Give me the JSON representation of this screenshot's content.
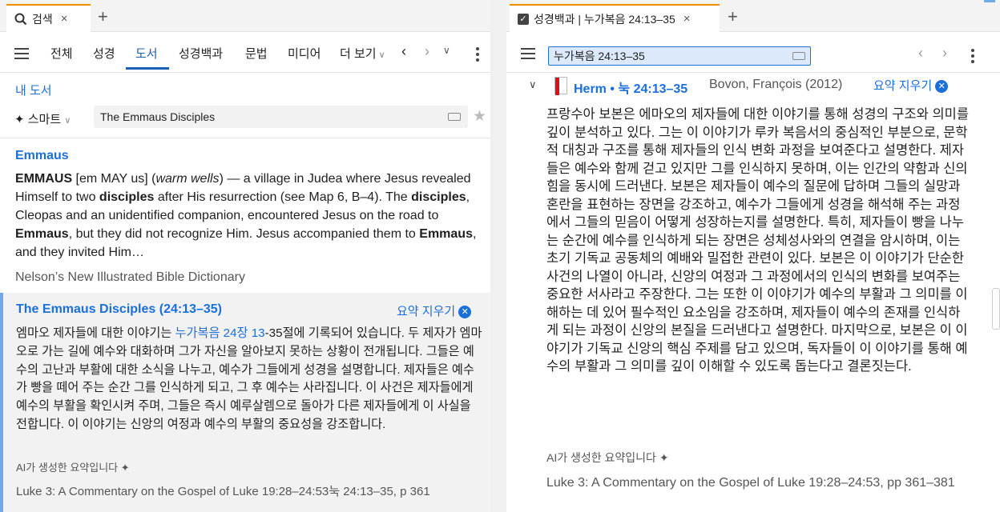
{
  "left": {
    "tab": {
      "label": "검색",
      "icon": "search-icon",
      "close": "×"
    },
    "new_tab": "+",
    "nav": [
      "전체",
      "성경",
      "도서",
      "성경백과",
      "문법",
      "미디어",
      "더 보기"
    ],
    "active_nav": "도서",
    "my_library": "내 도서",
    "smart_label": "스마트",
    "search_value": "The Emmaus Disciples",
    "entry": {
      "title": "Emmaus",
      "headword": "EMMAUS",
      "pron": " [em MAY us] (",
      "gloss": "warm wells",
      "t1": ") — a village in Judea where Jesus revealed Himself to two ",
      "b1": "disciples",
      "t2": " after His resurrection (see Map 6, B–4). The ",
      "b2": "disciples",
      "t3": ", Cleopas and an unidentified companion, encountered Jesus on the road to ",
      "b3": "Emmaus",
      "t4": ", but they did not recognize Him. Jesus accompanied them to ",
      "b4": "Emmaus",
      "t5": ", and they invited Him…",
      "source": "Nelson’s New Illustrated Bible Dictionary"
    },
    "summary": {
      "title": "The Emmaus Disciples (24:13–35)",
      "clear": "요약 지우기",
      "pre": "엠마오 제자들에 대한 이야기는 ",
      "link": "누가복음 24장 13",
      "body": "-35절에 기록되어 있습니다. 두 제자가 엠마오로 가는 길에 예수와 대화하며 그가 자신을 알아보지 못하는 상황이 전개됩니다. 그들은 예수의 고난과 부활에 대한 소식을 나누고, 예수가 그들에게 성경을 설명합니다. 제자들은 예수가 빵을 떼어 주는 순간 그를 인식하게 되고, 그 후 예수는 사라집니다. 이 사건은 제자들에게 예수의 부활을 확인시켜 주며, 그들은 즉시 예루살렘으로 돌아가 다른 제자들에게 이 사실을 전합니다. 이 이야기는 신앙의 여정과 예수의 부활의 중요성을 강조합니다.",
      "ai_note": "AI가 생성한 요약입니다",
      "source": "Luke 3: A Commentary on the Gospel of Luke 19:28–24:53눅 24:13–35, p 361"
    }
  },
  "right": {
    "tab": {
      "label": "성경백과 | 누가복음 24:13–35",
      "close": "×"
    },
    "new_tab": "+",
    "address": "누가복음 24:13–35",
    "result": {
      "resource": "Herm • 눅 24:13–35",
      "author": "Bovon, François (2012)",
      "clear": "요약 지우기",
      "body": "프랑수아 보본은 에마오의 제자들에 대한 이야기를 통해 성경의 구조와 의미를 깊이 분석하고 있다. 그는 이 이야기가 루카 복음서의 중심적인 부분으로, 문학적 대칭과 구조를 통해 제자들의 인식 변화 과정을 보여준다고 설명한다. 제자들은 예수와 함께 걷고 있지만 그를 인식하지 못하며, 이는 인간의 약함과 신의 힘을 동시에 드러낸다. 보본은 제자들이 예수의 질문에 답하며 그들의 실망과 혼란을 표현하는 장면을 강조하고, 예수가 그들에게 성경을 해석해 주는 과정에서 그들의 믿음이 어떻게 성장하는지를 설명한다. 특히, 제자들이 빵을 나누는 순간에 예수를 인식하게 되는 장면은 성체성사와의 연결을 암시하며, 이는 초기 기독교 공동체의 예배와 밀접한 관련이 있다. 보본은 이 이야기가 단순한 사건의 나열이 아니라, 신앙의 여정과 그 과정에서의 인식의 변화를 보여주는 중요한 서사라고 주장한다. 그는 또한 이 이야기가 예수의 부활과 그 의미를 이해하는 데 있어 필수적인 요소임을 강조하며, 제자들이 예수의 존재를 인식하게 되는 과정이 신앙의 본질을 드러낸다고 설명한다. 마지막으로, 보본은 이 이야기가 기독교 신앙의 핵심 주제를 담고 있으며, 독자들이 이 이야기를 통해 예수의 부활과 그 의미를 깊이 이해할 수 있도록 돕는다고 결론짓는다.",
      "ai_note": "AI가 생성한 요약입니다",
      "source": "Luke 3: A Commentary on the Gospel of Luke 19:28–24:53, pp 361–381"
    }
  },
  "colors": {
    "accent": "#1a6fd9",
    "tab_marker": "#f08c00",
    "summary_bg": "#f2f2f2"
  }
}
